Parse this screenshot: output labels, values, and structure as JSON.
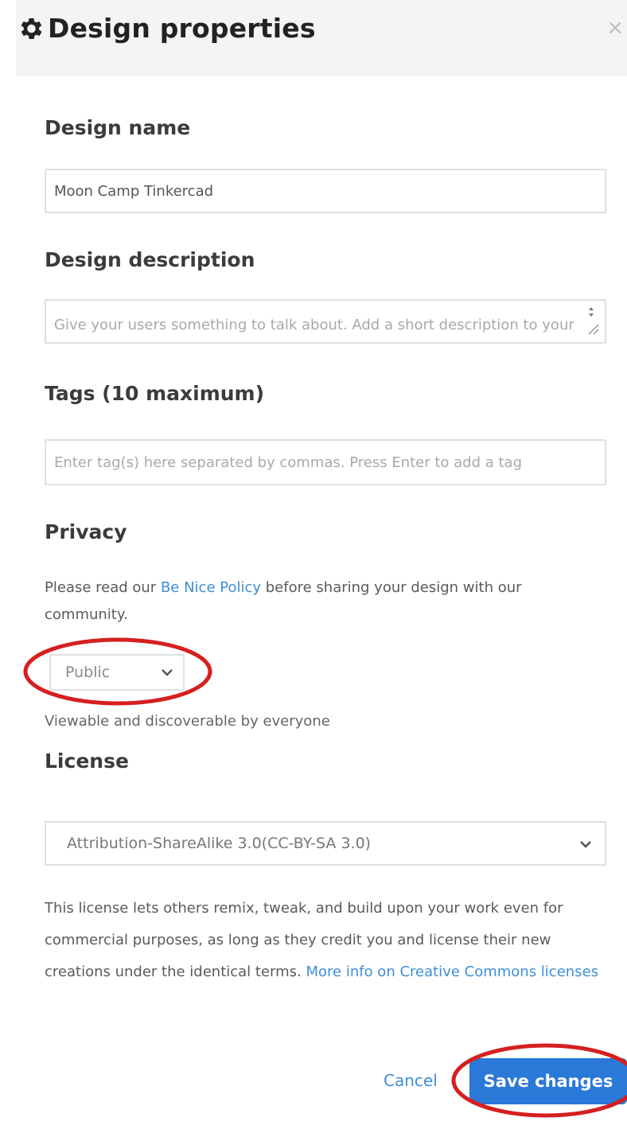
{
  "dialog": {
    "title": "Design properties",
    "close_label": "×"
  },
  "design_name": {
    "label": "Design name",
    "value": "Moon Camp Tinkercad"
  },
  "design_description": {
    "label": "Design description",
    "placeholder": "Give your users something to talk about. Add a short description to your design."
  },
  "tags": {
    "label": "Tags (10 maximum)",
    "placeholder": "Enter tag(s) here separated by commas. Press Enter to add a tag"
  },
  "privacy": {
    "label": "Privacy",
    "notice_before": "Please read our ",
    "notice_link": "Be Nice Policy",
    "notice_after": " before sharing your design with our community.",
    "selected": "Public",
    "hint": "Viewable and discoverable by everyone"
  },
  "license": {
    "label": "License",
    "selected": "Attribution-ShareAlike 3.0(CC-BY-SA 3.0)",
    "description": "This license lets others remix, tweak, and build upon your work even for commercial purposes, as long as they credit you and license their new creations under the identical terms. ",
    "more_info_link": "More info on Creative Commons licenses"
  },
  "actions": {
    "cancel_label": "Cancel",
    "save_label": "Save changes"
  },
  "colors": {
    "primary": "#2a78d8",
    "link": "#3f8ed8",
    "annotation": "#d61f1f",
    "header_bg": "#f4f4f4"
  }
}
